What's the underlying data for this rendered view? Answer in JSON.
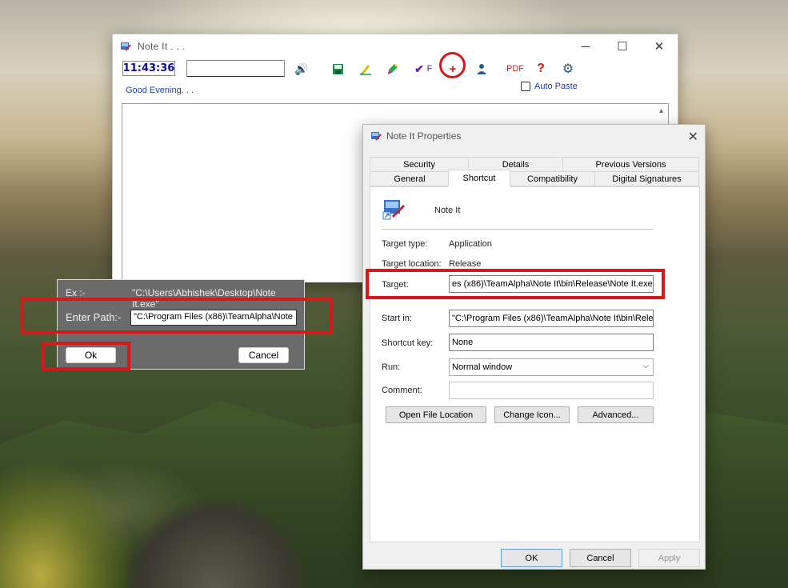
{
  "main_window": {
    "title": "Note It . . .",
    "controls": {
      "minimize": "─",
      "maximize": "☐",
      "close": "✕"
    },
    "clock": "11:43:36",
    "toolbar_input_value": "",
    "greeting": "Good Evening. . .",
    "auto_paste_label": "Auto Paste",
    "icons": {
      "speaker": "🔊",
      "spell_check": "✔",
      "spell_check_letter": "F",
      "add": "+",
      "pdf": "PDF",
      "help": "?",
      "settings": "⚙"
    }
  },
  "path_dialog": {
    "ex_label": "Ex :-",
    "ex_value": "\"C:\\Users\\Abhishek\\Desktop\\Note It.exe\"",
    "enter_path_label": "Enter Path:-",
    "path_value": "\"C:\\Program Files (x86)\\TeamAlpha\\Note It",
    "ok_label": "Ok",
    "cancel_label": "Cancel"
  },
  "properties": {
    "title": "Note It Properties",
    "close": "✕",
    "tabs_row1": [
      "Security",
      "Details",
      "Previous Versions"
    ],
    "tabs_row2": [
      "General",
      "Shortcut",
      "Compatibility",
      "Digital Signatures"
    ],
    "app_name": "Note It",
    "target_type_label": "Target type:",
    "target_type_value": "Application",
    "target_location_label": "Target location:",
    "target_location_value": "Release",
    "target_label": "Target:",
    "target_value": "es (x86)\\TeamAlpha\\Note It\\bin\\Release\\Note It.exe\"",
    "start_in_label": "Start in:",
    "start_in_value": "\"C:\\Program Files (x86)\\TeamAlpha\\Note It\\bin\\Relea",
    "shortcut_key_label": "Shortcut key:",
    "shortcut_key_value": "None",
    "run_label": "Run:",
    "run_value": "Normal window",
    "comment_label": "Comment:",
    "comment_value": "",
    "open_file_location_label": "Open File Location",
    "change_icon_label": "Change Icon...",
    "advanced_label": "Advanced...",
    "ok_label": "OK",
    "cancel_label": "Cancel",
    "apply_label": "Apply"
  },
  "colors": {
    "highlight_red": "#d81818",
    "greeting_blue": "#1f3cb4",
    "clock_blue": "#0a0a96"
  }
}
